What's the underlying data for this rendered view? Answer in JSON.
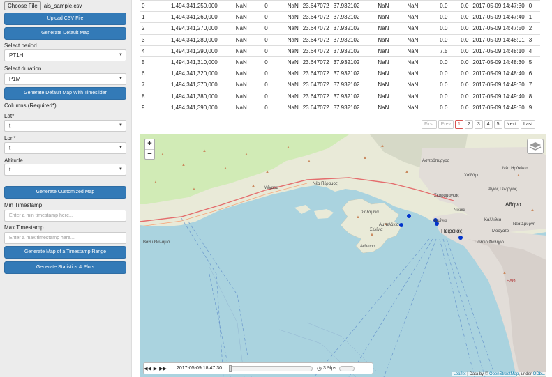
{
  "sidebar": {
    "choose_file": "Choose File",
    "file_name": "ais_sample.csv",
    "upload_button": "Upload CSV File",
    "default_map_button": "Generate Default Map",
    "select_period_label": "Select period",
    "period_value": "PT1H",
    "select_duration_label": "Select duration",
    "duration_value": "P1M",
    "timeslider_button": "Generate Default Map With Timeslider",
    "columns_label": "Columns (Required*)",
    "lat_label": "Lat*",
    "lat_value": "t",
    "lon_label": "Lon*",
    "lon_value": "t",
    "altitude_label": "Altitude",
    "altitude_value": "t",
    "customized_map_button": "Generate Customized Map",
    "min_timestamp_label": "Min Timestamp",
    "min_timestamp_placeholder": "Enter a min timestamp here...",
    "max_timestamp_label": "Max Timestamp",
    "max_timestamp_placeholder": "Enter a max timestamp here...",
    "range_map_button": "Generate Map of a Timestamp Range",
    "stats_button": "Generate Statistics & Plots"
  },
  "table": {
    "rows": [
      [
        "0",
        "1,494,341,250,000",
        "NaN",
        "0",
        "NaN",
        "23.647072",
        "37.932102",
        "NaN",
        "NaN",
        "0.0",
        "0.0",
        "2017-05-09 14:47:30",
        "0"
      ],
      [
        "1",
        "1,494,341,260,000",
        "NaN",
        "0",
        "NaN",
        "23.647072",
        "37.932102",
        "NaN",
        "NaN",
        "0.0",
        "0.0",
        "2017-05-09 14:47:40",
        "1"
      ],
      [
        "2",
        "1,494,341,270,000",
        "NaN",
        "0",
        "NaN",
        "23.647072",
        "37.932102",
        "NaN",
        "NaN",
        "0.0",
        "0.0",
        "2017-05-09 14:47:50",
        "2"
      ],
      [
        "3",
        "1,494,341,280,000",
        "NaN",
        "0",
        "NaN",
        "23.647072",
        "37.932102",
        "NaN",
        "NaN",
        "0.0",
        "0.0",
        "2017-05-09 14:48:01",
        "3"
      ],
      [
        "4",
        "1,494,341,290,000",
        "NaN",
        "0",
        "NaN",
        "23.647072",
        "37.932102",
        "NaN",
        "NaN",
        "7.5",
        "0.0",
        "2017-05-09 14:48:10",
        "4"
      ],
      [
        "5",
        "1,494,341,310,000",
        "NaN",
        "0",
        "NaN",
        "23.647072",
        "37.932102",
        "NaN",
        "NaN",
        "0.0",
        "0.0",
        "2017-05-09 14:48:30",
        "5"
      ],
      [
        "6",
        "1,494,341,320,000",
        "NaN",
        "0",
        "NaN",
        "23.647072",
        "37.932102",
        "NaN",
        "NaN",
        "0.0",
        "0.0",
        "2017-05-09 14:48:40",
        "6"
      ],
      [
        "7",
        "1,494,341,370,000",
        "NaN",
        "0",
        "NaN",
        "23.647072",
        "37.932102",
        "NaN",
        "NaN",
        "0.0",
        "0.0",
        "2017-05-09 14:49:30",
        "7"
      ],
      [
        "8",
        "1,494,341,380,000",
        "NaN",
        "0",
        "NaN",
        "23.647072",
        "37.932102",
        "NaN",
        "NaN",
        "0.0",
        "0.0",
        "2017-05-09 14:49:40",
        "8"
      ],
      [
        "9",
        "1,494,341,390,000",
        "NaN",
        "0",
        "NaN",
        "23.647072",
        "37.932102",
        "NaN",
        "NaN",
        "0.0",
        "0.0",
        "2017-05-09 14:49:50",
        "9"
      ]
    ]
  },
  "pagination": {
    "first": "First",
    "prev": "Prev",
    "pages": [
      "1",
      "2",
      "3",
      "4",
      "5"
    ],
    "next": "Next",
    "last": "Last"
  },
  "map": {
    "zoom_in": "+",
    "zoom_out": "−",
    "labels": {
      "megara": "Μέγαρα",
      "nea_peramos": "Νέα Πέραμος",
      "salamina": "Σαλαμίνα",
      "ampelakia": "Αμπελάκια",
      "eantio": "Σελίνια",
      "aiantio": "Αιάντειο",
      "athina": "Αθήνα",
      "peiraias": "Πειραιάς",
      "kallithea": "Καλλιθέα",
      "palaio_faliro": "Παλαιό Φάληρο",
      "nikaia": "Νίκαια",
      "kaminia": "Καμίνια",
      "aspropyrgos": "Ασπρόπυργος",
      "chaidari": "Χαϊδάρι",
      "skaramangas": "Σκαραμαγκάς",
      "nea_iraklia": "Νέα Ηράκλεια",
      "agios_georgios": "Άγιος Γεώργιος",
      "nea_smyrni": "Νέα Σμύρνη",
      "moschato": "Μοσχάτο",
      "bay": "Βαθύ Θαλάμιο",
      "edw": "ΕΔΘΙ"
    },
    "timeline_time": "2017-05-09 18:47:30",
    "speed": "3.9fps",
    "attribution_leaflet": "Leaflet",
    "attribution_mid": "| Data by ©",
    "attribution_osm": "OpenStreetMap",
    "attribution_under": ", under",
    "attribution_odbl": "ODbL."
  }
}
